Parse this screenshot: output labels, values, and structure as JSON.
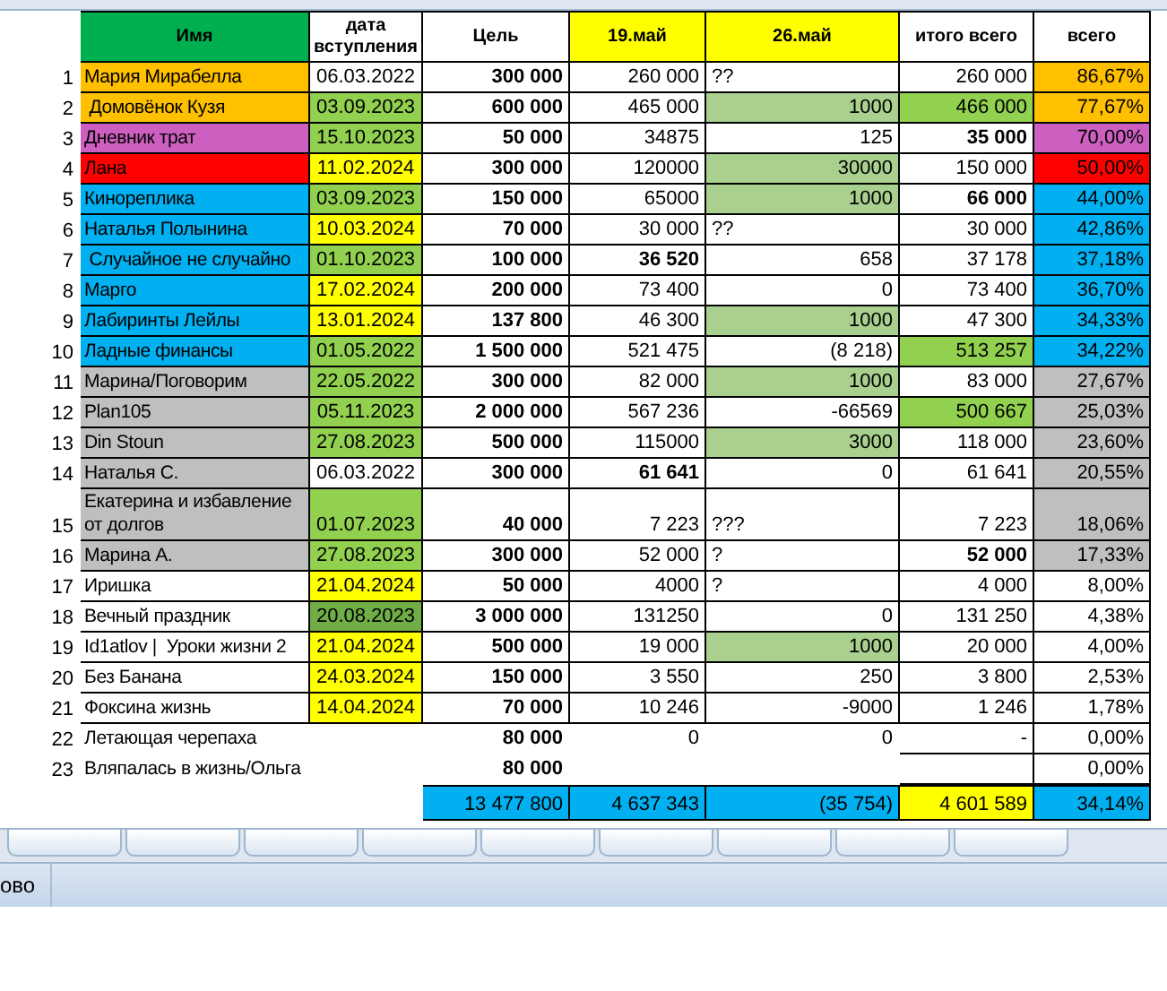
{
  "columns": [
    {
      "text": "Имя",
      "color": "#00b050"
    },
    {
      "text": "дата вступления"
    },
    {
      "text": "Цель"
    },
    {
      "text": "19.май",
      "color": "#ffff00"
    },
    {
      "text": "26.май",
      "color": "#ffff00"
    },
    {
      "text": "итого всего"
    },
    {
      "text": "всего"
    }
  ],
  "rows": [
    {
      "num": "1",
      "name": {
        "text": "Мария Мирабелла",
        "color": "#ffc000"
      },
      "date": {
        "text": "06.03.2022"
      },
      "goal": {
        "text": "300 000"
      },
      "may19": {
        "text": "260 000"
      },
      "may26": {
        "note": "??"
      },
      "total": {
        "text": "260 000"
      },
      "percent": {
        "text": "86,67%",
        "color": "#ffc000"
      }
    },
    {
      "num": "2",
      "name": {
        "text": " Домовёнок Кузя",
        "color": "#ffc000"
      },
      "date": {
        "text": "03.09.2023",
        "color": "#92d050"
      },
      "goal": {
        "text": "600 000"
      },
      "may19": {
        "text": "465 000"
      },
      "may26": {
        "text": "1000",
        "color": "#a9d08e"
      },
      "total": {
        "text": "466 000",
        "color": "#92d050"
      },
      "percent": {
        "text": "77,67%",
        "color": "#ffc000"
      }
    },
    {
      "num": "3",
      "name": {
        "text": "Дневник трат",
        "color": "#cc5fc0"
      },
      "date": {
        "text": "15.10.2023",
        "color": "#92d050"
      },
      "goal": {
        "text": "50 000"
      },
      "may19": {
        "text": "34875"
      },
      "may26": {
        "text": "125"
      },
      "total": {
        "text": "35 000",
        "bold": true
      },
      "percent": {
        "text": "70,00%",
        "color": "#cc5fc0"
      }
    },
    {
      "num": "4",
      "name": {
        "text": "Лана",
        "color": "#ff0000"
      },
      "date": {
        "text": "11.02.2024",
        "color": "#ffff00"
      },
      "goal": {
        "text": "300 000"
      },
      "may19": {
        "text": "120000"
      },
      "may26": {
        "text": "30000",
        "color": "#a9d08e"
      },
      "total": {
        "text": "150 000"
      },
      "percent": {
        "text": "50,00%",
        "color": "#ff0000"
      }
    },
    {
      "num": "5",
      "name": {
        "text": "Кинореплика",
        "color": "#00b0f0"
      },
      "date": {
        "text": "03.09.2023",
        "color": "#92d050"
      },
      "goal": {
        "text": "150 000"
      },
      "may19": {
        "text": "65000"
      },
      "may26": {
        "text": "1000",
        "color": "#a9d08e"
      },
      "total": {
        "text": "66 000",
        "bold": true
      },
      "percent": {
        "text": "44,00%",
        "color": "#00b0f0"
      }
    },
    {
      "num": "6",
      "name": {
        "text": "Наталья Полынина",
        "color": "#00b0f0"
      },
      "date": {
        "text": "10.03.2024",
        "color": "#ffff00"
      },
      "goal": {
        "text": "70 000"
      },
      "may19": {
        "text": "30 000"
      },
      "may26": {
        "note": "??"
      },
      "total": {
        "text": "30 000"
      },
      "percent": {
        "text": "42,86%",
        "color": "#00b0f0"
      }
    },
    {
      "num": "7",
      "name": {
        "text": " Случайное не случайно",
        "color": "#00b0f0"
      },
      "date": {
        "text": "01.10.2023",
        "color": "#92d050"
      },
      "goal": {
        "text": "100 000"
      },
      "may19": {
        "text": "36 520",
        "bold": true
      },
      "may26": {
        "text": "658"
      },
      "total": {
        "text": "37 178"
      },
      "percent": {
        "text": "37,18%",
        "color": "#00b0f0"
      }
    },
    {
      "num": "8",
      "name": {
        "text": "Марго",
        "color": "#00b0f0"
      },
      "date": {
        "text": "17.02.2024",
        "color": "#ffff00"
      },
      "goal": {
        "text": "200 000"
      },
      "may19": {
        "text": "73 400"
      },
      "may26": {
        "text": "0"
      },
      "total": {
        "text": "73 400"
      },
      "percent": {
        "text": "36,70%",
        "color": "#00b0f0"
      }
    },
    {
      "num": "9",
      "name": {
        "text": "Лабиринты Лейлы",
        "color": "#00b0f0"
      },
      "date": {
        "text": "13.01.2024",
        "color": "#ffff00"
      },
      "goal": {
        "text": "137 800"
      },
      "may19": {
        "text": "46 300"
      },
      "may26": {
        "text": "1000",
        "color": "#a9d08e"
      },
      "total": {
        "text": "47 300"
      },
      "percent": {
        "text": "34,33%",
        "color": "#00b0f0"
      }
    },
    {
      "num": "10",
      "name": {
        "text": "Ладные финансы",
        "color": "#00b0f0"
      },
      "date": {
        "text": "01.05.2022",
        "color": "#92d050"
      },
      "goal": {
        "text": "1 500 000"
      },
      "may19": {
        "text": "521 475"
      },
      "may26": {
        "text": "(8 218)"
      },
      "total": {
        "text": "513 257",
        "color": "#92d050"
      },
      "percent": {
        "text": "34,22%",
        "color": "#00b0f0"
      }
    },
    {
      "num": "11",
      "name": {
        "text": "Марина/Поговорим",
        "color": "#bfbfbf"
      },
      "date": {
        "text": "22.05.2022",
        "color": "#92d050"
      },
      "goal": {
        "text": "300 000"
      },
      "may19": {
        "text": "82 000"
      },
      "may26": {
        "text": "1000",
        "color": "#a9d08e"
      },
      "total": {
        "text": "83 000"
      },
      "percent": {
        "text": "27,67%",
        "color": "#bfbfbf"
      }
    },
    {
      "num": "12",
      "name": {
        "text": "Plan105",
        "color": "#bfbfbf"
      },
      "date": {
        "text": "05.11.2023",
        "color": "#92d050"
      },
      "goal": {
        "text": "2 000 000"
      },
      "may19": {
        "text": "567 236"
      },
      "may26": {
        "text": "-66569"
      },
      "total": {
        "text": "500 667",
        "color": "#92d050"
      },
      "percent": {
        "text": "25,03%",
        "color": "#bfbfbf"
      }
    },
    {
      "num": "13",
      "name": {
        "text": "Din Stoun",
        "color": "#bfbfbf"
      },
      "date": {
        "text": "27.08.2023",
        "color": "#92d050"
      },
      "goal": {
        "text": "500 000"
      },
      "may19": {
        "text": "115000"
      },
      "may26": {
        "text": "3000",
        "color": "#a9d08e"
      },
      "total": {
        "text": "118 000"
      },
      "percent": {
        "text": "23,60%",
        "color": "#bfbfbf"
      }
    },
    {
      "num": "14",
      "name": {
        "text": "Наталья С.",
        "color": "#bfbfbf"
      },
      "date": {
        "text": "06.03.2022"
      },
      "goal": {
        "text": "300 000"
      },
      "may19": {
        "text": "61 641",
        "bold": true
      },
      "may26": {
        "text": "0"
      },
      "total": {
        "text": "61 641"
      },
      "percent": {
        "text": "20,55%",
        "color": "#bfbfbf"
      }
    },
    {
      "num": "15",
      "name": {
        "text": "Екатерина и избавление от долгов",
        "color": "#bfbfbf"
      },
      "date": {
        "text": "01.07.2023",
        "color": "#92d050"
      },
      "goal": {
        "text": "40 000"
      },
      "may19": {
        "text": "7 223"
      },
      "may26": {
        "note": "???"
      },
      "total": {
        "text": "7 223"
      },
      "percent": {
        "text": "18,06%",
        "color": "#bfbfbf"
      }
    },
    {
      "num": "16",
      "name": {
        "text": "Марина А.",
        "color": "#bfbfbf"
      },
      "date": {
        "text": "27.08.2023",
        "color": "#92d050"
      },
      "goal": {
        "text": "300 000"
      },
      "may19": {
        "text": "52 000"
      },
      "may26": {
        "note": "?"
      },
      "total": {
        "text": "52 000",
        "bold": true
      },
      "percent": {
        "text": "17,33%",
        "color": "#bfbfbf"
      }
    },
    {
      "num": "17",
      "name": {
        "text": "Иришка"
      },
      "date": {
        "text": "21.04.2024",
        "color": "#ffff00"
      },
      "goal": {
        "text": "50 000"
      },
      "may19": {
        "text": "4000"
      },
      "may26": {
        "note": "?"
      },
      "total": {
        "text": "4 000"
      },
      "percent": {
        "text": "8,00%"
      }
    },
    {
      "num": "18",
      "name": {
        "text": "Вечный праздник"
      },
      "date": {
        "text": "20.08.2023",
        "color": "#70ad47"
      },
      "goal": {
        "text": "3 000 000"
      },
      "may19": {
        "text": "131250"
      },
      "may26": {
        "text": "0"
      },
      "total": {
        "text": "131 250"
      },
      "percent": {
        "text": "4,38%"
      }
    },
    {
      "num": "19",
      "name": {
        "text": "Id1atlov |  Уроки жизни 2"
      },
      "date": {
        "text": "21.04.2024",
        "color": "#ffff00"
      },
      "goal": {
        "text": "500 000"
      },
      "may19": {
        "text": "19 000"
      },
      "may26": {
        "text": "1000",
        "color": "#a9d08e"
      },
      "total": {
        "text": "20 000"
      },
      "percent": {
        "text": "4,00%"
      }
    },
    {
      "num": "20",
      "name": {
        "text": "Без Банана"
      },
      "date": {
        "text": "24.03.2024",
        "color": "#ffff00"
      },
      "goal": {
        "text": "150 000"
      },
      "may19": {
        "text": "3 550"
      },
      "may26": {
        "text": "250"
      },
      "total": {
        "text": "3 800"
      },
      "percent": {
        "text": "2,53%"
      }
    },
    {
      "num": "21",
      "name": {
        "text": "Фоксина жизнь"
      },
      "date": {
        "text": "14.04.2024",
        "color": "#ffff00"
      },
      "goal": {
        "text": "70 000"
      },
      "may19": {
        "text": "10 246"
      },
      "may26": {
        "text": "-9000"
      },
      "total": {
        "text": "1 246"
      },
      "percent": {
        "text": "1,78%"
      }
    },
    {
      "num": "22",
      "name": {
        "text": "Летающая черепаха"
      },
      "date": {},
      "goal": {
        "text": "80 000"
      },
      "may19": {
        "text": "0"
      },
      "may26": {
        "text": "0"
      },
      "total": {
        "text": "-"
      },
      "percent": {
        "text": "0,00%"
      }
    },
    {
      "num": "23",
      "name": {
        "text": "Вляпалась в жизнь/Ольга"
      },
      "date": {},
      "goal": {
        "text": "80 000"
      },
      "may19": {},
      "may26": {},
      "total": {},
      "percent": {
        "text": "0,00%"
      }
    }
  ],
  "totals": {
    "goal": {
      "text": "13 477 800",
      "color": "#00b0f0"
    },
    "may19": {
      "text": "4 637 343",
      "color": "#00b0f0"
    },
    "may26": {
      "text": "(35 754)",
      "color": "#00b0f0"
    },
    "total": {
      "text": "4 601 589",
      "color": "#ffff00"
    },
    "percent": {
      "text": "34,14%",
      "color": "#00b0f0"
    }
  },
  "status_bar": {
    "text": "ово"
  }
}
